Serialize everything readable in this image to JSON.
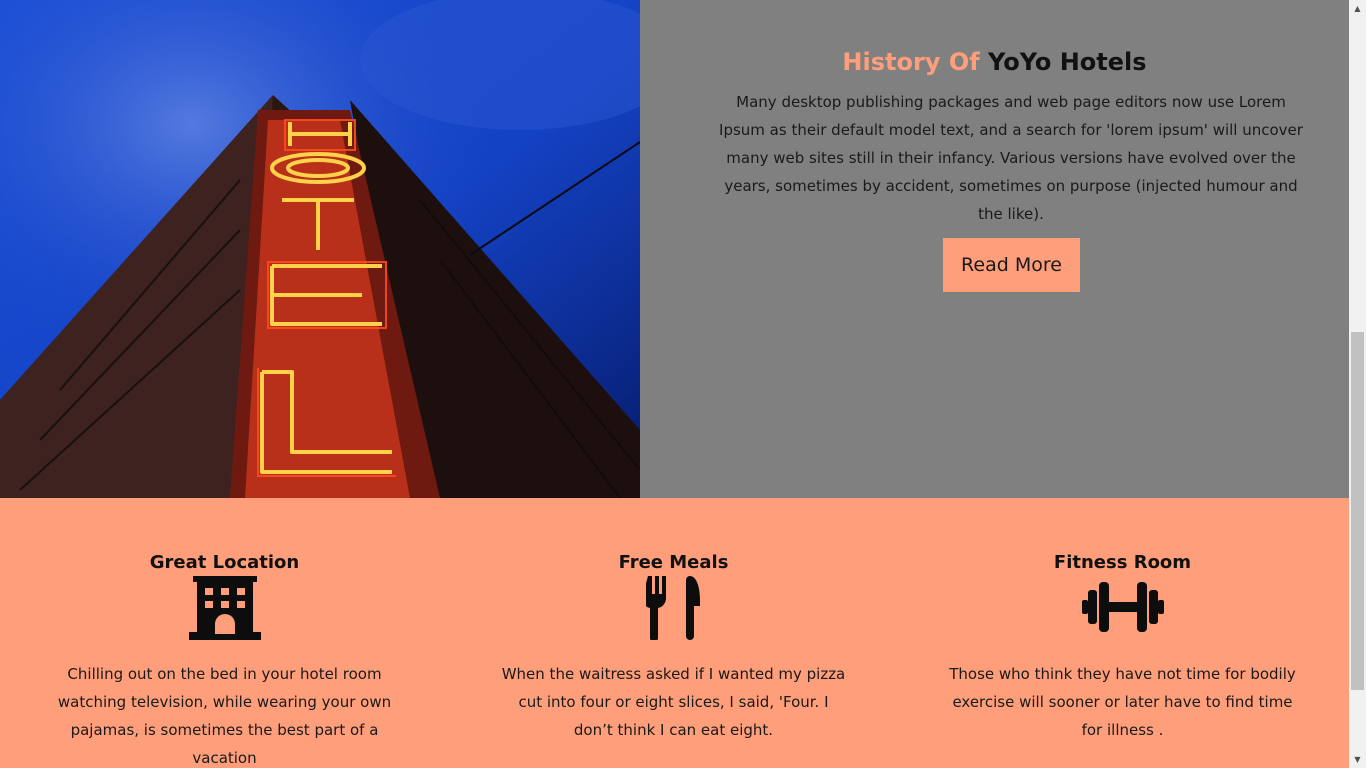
{
  "history": {
    "title_accent": "History Of",
    "title_main": "YoYo Hotels",
    "text": "Many desktop publishing packages and web page editors now use Lorem Ipsum as their default model text, and a search for 'lorem ipsum' will uncover many web sites still in their infancy. Various versions have evolved over the years, sometimes by accident, sometimes on purpose (injected humour and the like).",
    "button_label": "Read More"
  },
  "hero": {
    "sign_letters": "HOTEL",
    "icon": "hotel-neon-sign-image"
  },
  "features": [
    {
      "title": "Great Location",
      "icon": "building-icon",
      "text": "Chilling out on the bed in your hotel room watching television, while wearing your own pajamas, is sometimes the best part of a vacation"
    },
    {
      "title": "Free Meals",
      "icon": "utensils-icon",
      "text": "When the waitress asked if I wanted my pizza cut into four or eight slices, I said, 'Four. I don’t think I can eat eight."
    },
    {
      "title": "Fitness Room",
      "icon": "dumbbell-icon",
      "text": "Those who think they have not time for bodily exercise will sooner or later have to find time for illness ."
    }
  ],
  "colors": {
    "accent": "#ff9e7a",
    "panel_gray": "#808080",
    "text_dark": "#111111"
  }
}
